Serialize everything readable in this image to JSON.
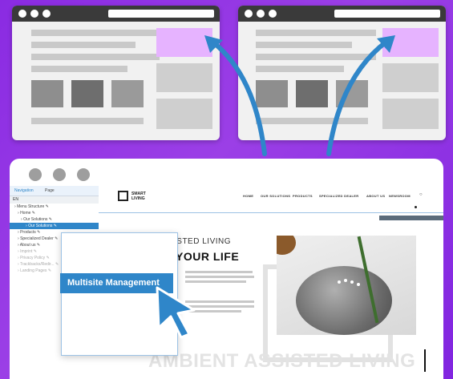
{
  "colors": {
    "background": "#8a2be2",
    "accent_blue": "#2f86c9",
    "highlight_pink": "#e6b3ff",
    "dark_bar": "#3a3a3a"
  },
  "navigator": {
    "tabs": [
      "Navigation",
      "Page"
    ],
    "language": "EN",
    "items": [
      {
        "label": "Menu Structure",
        "state": "normal"
      },
      {
        "label": "Home",
        "state": "normal"
      },
      {
        "label": "Our Solutions",
        "state": "normal"
      },
      {
        "label": "Our Solutions",
        "state": "selected"
      },
      {
        "label": "Products",
        "state": "normal"
      },
      {
        "label": "Specialized Dealer",
        "state": "normal"
      },
      {
        "label": "About us",
        "state": "normal"
      },
      {
        "label": "Imprint",
        "state": "dim"
      },
      {
        "label": "Privacy Policy",
        "state": "dim"
      },
      {
        "label": "Trackbacks/Redir...",
        "state": "dim"
      },
      {
        "label": "Landing Pages",
        "state": "dim"
      }
    ]
  },
  "site": {
    "logo_line1": "SMART",
    "logo_line2": "LIVING",
    "menu": [
      "HOME",
      "OUR SOLUTIONS",
      "PRODUCTS",
      "SPECIALIZED DEALER",
      "ABOUT US",
      "NEWSROOM"
    ],
    "hero_small": "ISTED LIVING",
    "hero_big": "YOUR LIFE",
    "footer_headline": "AMBIENT ASSISTED LIVING"
  },
  "popup": {
    "button_label": "Multisite Management"
  }
}
